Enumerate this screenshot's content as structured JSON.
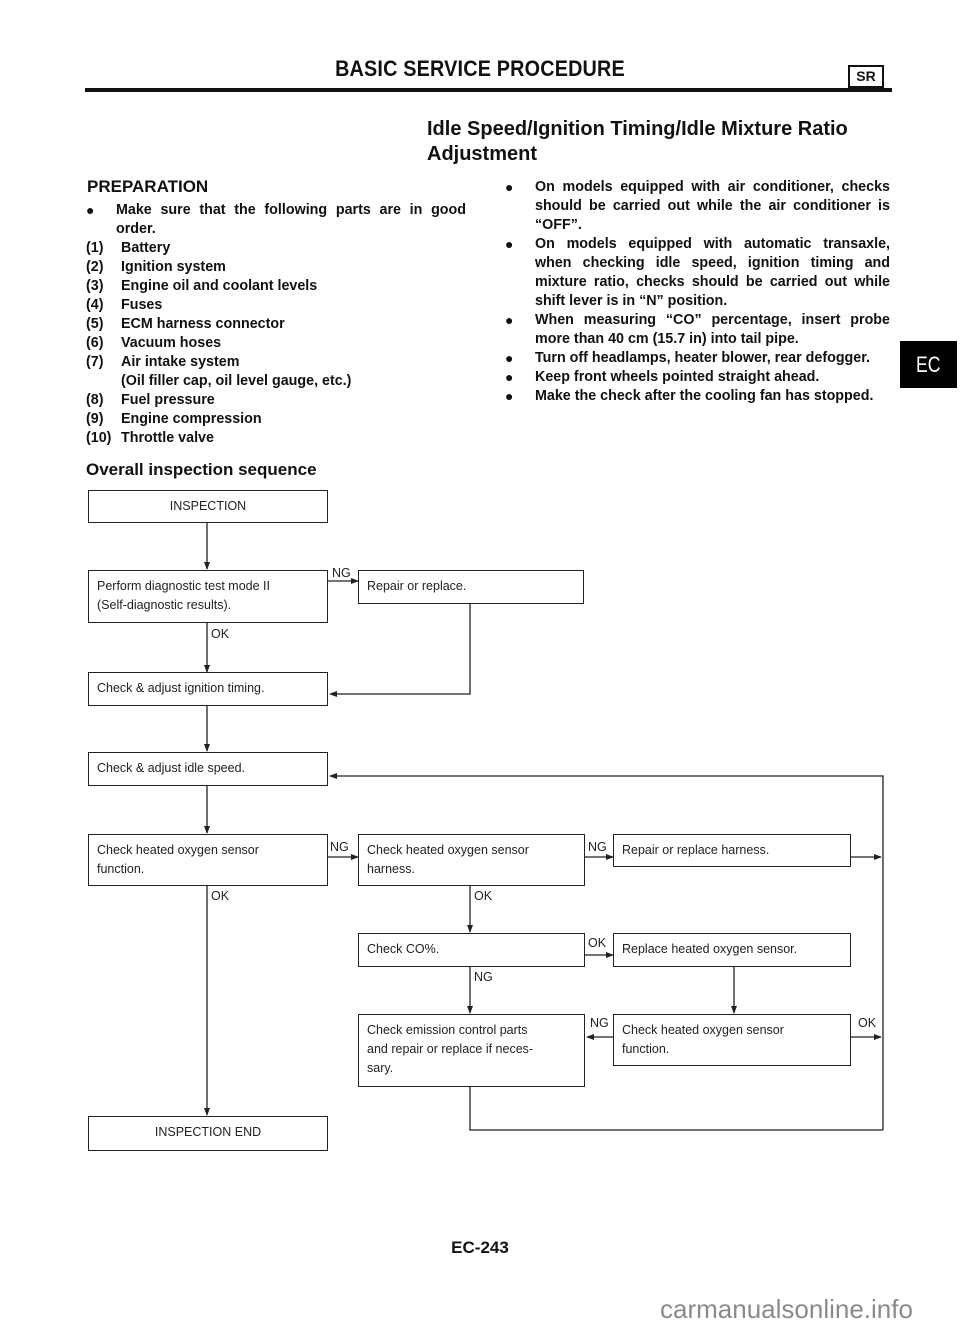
{
  "header": {
    "title": "BASIC SERVICE PROCEDURE",
    "badge": "SR"
  },
  "section_title_line1": "Idle Speed/Ignition Timing/Idle Mixture Ratio",
  "section_title_line2": "Adjustment",
  "preparation": {
    "title": "PREPARATION",
    "intro_bullet": "Make sure that the following parts are in good order.",
    "items": [
      {
        "num": "(1)",
        "text": "Battery"
      },
      {
        "num": "(2)",
        "text": "Ignition system"
      },
      {
        "num": "(3)",
        "text": "Engine oil and coolant levels"
      },
      {
        "num": "(4)",
        "text": "Fuses"
      },
      {
        "num": "(5)",
        "text": "ECM harness connector"
      },
      {
        "num": "(6)",
        "text": "Vacuum hoses"
      },
      {
        "num": "(7)",
        "text": "Air intake system"
      },
      {
        "num": "",
        "text": "(Oil filler cap, oil level gauge, etc.)"
      },
      {
        "num": "(8)",
        "text": "Fuel pressure"
      },
      {
        "num": "(9)",
        "text": "Engine compression"
      },
      {
        "num": "(10)",
        "text": "Throttle valve"
      }
    ]
  },
  "notes": [
    "On models equipped with air conditioner, checks should be carried out while the air conditioner is “OFF”.",
    "On models equipped with automatic transaxle, when checking idle speed, ignition timing and mixture ratio, checks should be carried out while shift lever is in “N” position.",
    "When measuring “CO” percentage, insert probe more than 40 cm (15.7 in) into tail pipe.",
    "Turn off headlamps, heater blower, rear defogger.",
    "Keep front wheels pointed straight ahead.",
    "Make the check after the cooling fan has stopped."
  ],
  "bullet_glyph": "●",
  "side_tab": "EC",
  "sequence": {
    "title": "Overall inspection sequence",
    "boxes": {
      "inspection": "INSPECTION",
      "diag_line1": "Perform diagnostic test mode II",
      "diag_line2": "(Self-diagnostic results).",
      "repair": "Repair or replace.",
      "ignition": "Check & adjust ignition timing.",
      "idle": "Check & adjust idle speed.",
      "o2_func_line1": "Check heated oxygen sensor",
      "o2_func_line2": "function.",
      "o2_harness_line1": "Check heated oxygen sensor",
      "o2_harness_line2": "harness.",
      "repair_harness": "Repair or replace harness.",
      "co": "Check CO%.",
      "replace_o2": "Replace heated oxygen sensor.",
      "emission_line1": "Check emission control parts",
      "emission_line2": "and repair or replace if neces-",
      "emission_line3": "sary.",
      "o2_func2_line1": "Check heated oxygen sensor",
      "o2_func2_line2": "function.",
      "end": "INSPECTION END"
    },
    "labels": {
      "ng": "NG",
      "ok": "OK"
    }
  },
  "page_number": "EC-243",
  "watermark": "carmanualsonline.info"
}
